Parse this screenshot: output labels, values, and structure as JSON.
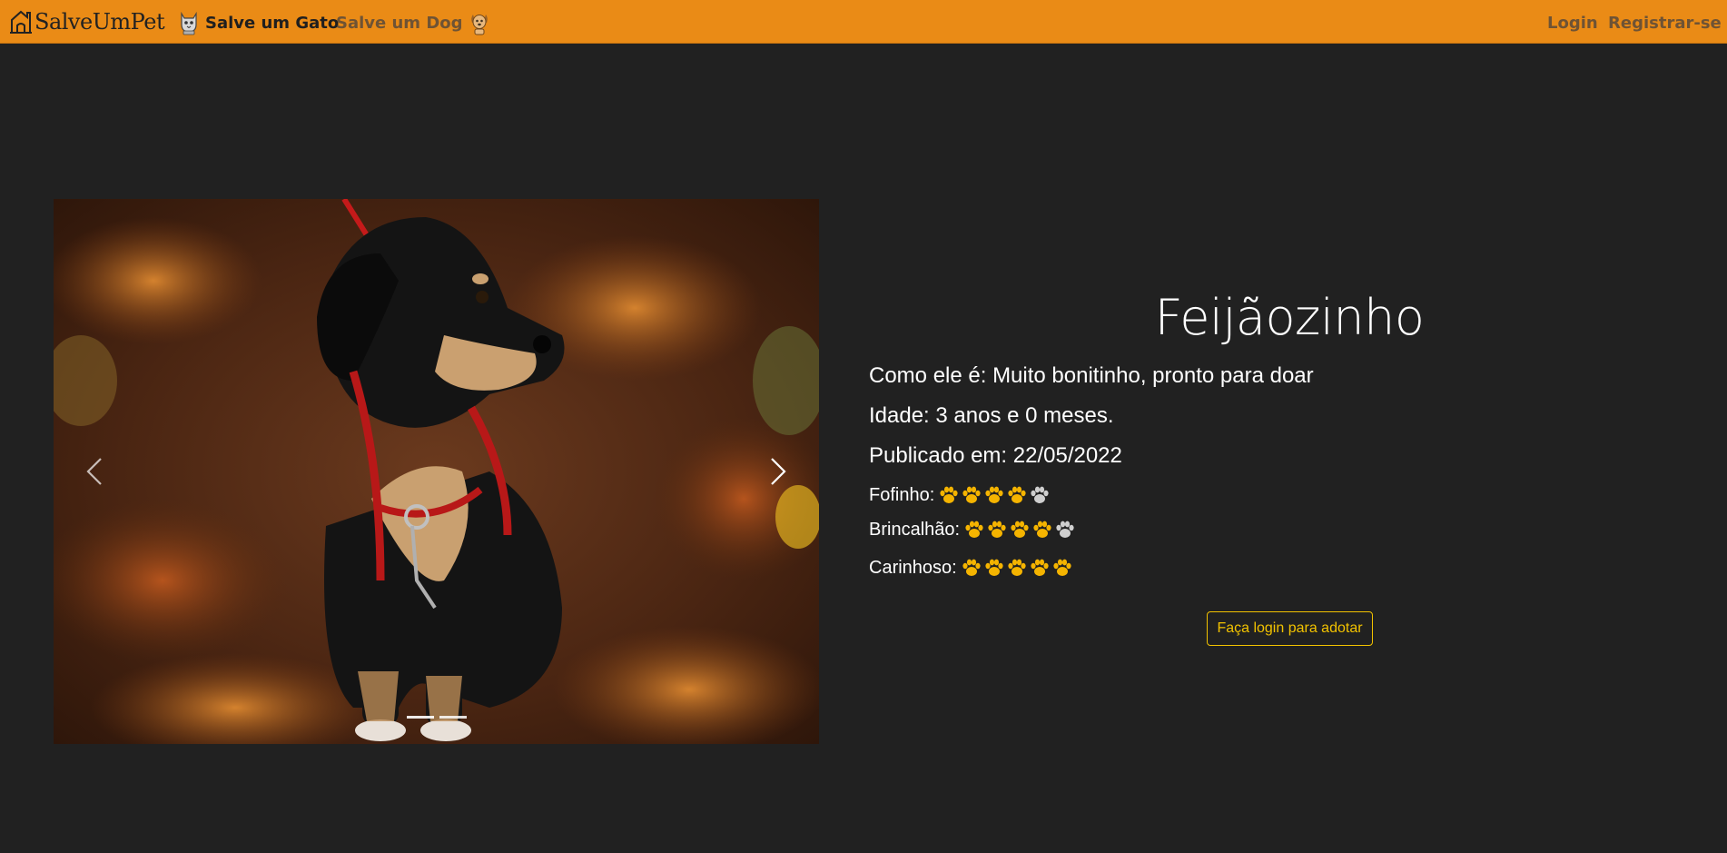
{
  "nav": {
    "brand": "SalveUmPet",
    "cat_link": "Salve um Gato",
    "dog_link": "Salve um Dog",
    "login": "Login",
    "register": "Registrar-se",
    "bar_color": "#ea8b16"
  },
  "carousel": {
    "slides": 2,
    "active": 0
  },
  "pet": {
    "name": "Feijãozinho",
    "description": "Como ele é: Muito bonitinho, pronto para doar",
    "age": "Idade: 3 anos e 0 meses.",
    "published": "Publicado em: 22/05/2022"
  },
  "ratings": [
    {
      "label": "Fofinho:",
      "value": 4,
      "max": 5
    },
    {
      "label": "Brincalhão:",
      "value": 4,
      "max": 5
    },
    {
      "label": "Carinhoso:",
      "value": 5,
      "max": 5
    }
  ],
  "paw_colors": {
    "filled": "#f5b400",
    "empty": "#cfcfcf"
  },
  "adopt_button": "Faça login para adotar"
}
